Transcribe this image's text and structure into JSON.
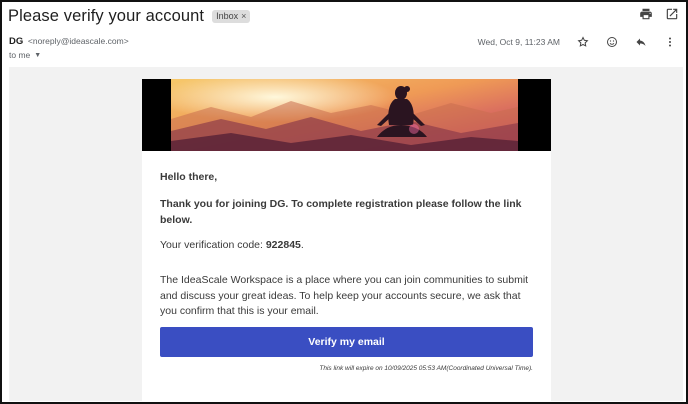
{
  "email": {
    "subject": "Please verify your account",
    "label": "Inbox",
    "label_remove": "×",
    "sender_name": "DG",
    "sender_email": "<noreply@ideascale.com>",
    "recipient": "to me",
    "recipient_caret": "▼",
    "date": "Wed, Oct 9, 11:23 AM"
  },
  "icons": {
    "print": "print-icon",
    "popout": "open-in-new-window-icon",
    "star": "star-icon",
    "emoji": "emoji-reaction-icon",
    "reply": "reply-icon",
    "more": "more-vertical-icon"
  },
  "message": {
    "greeting": "Hello there,",
    "thanks": "Thank you for joining DG. To complete registration please follow the link below.",
    "code_prefix": "Your verification code: ",
    "code": "922845",
    "code_suffix": ".",
    "description": "The IdeaScale Workspace is a place where you can join communities to submit and discuss your great ideas. To help keep your accounts secure, we ask that you confirm that this is your email.",
    "button": "Verify my email",
    "expiry": "This link will expire on 10/09/2025 05:53 AM(Coordinated Universal Time)."
  },
  "colors": {
    "button": "#3a4ec2",
    "body_background": "#f2f2f2",
    "banner_sky_top": "#f6c86a",
    "banner_sky_bottom": "#c0386a"
  }
}
